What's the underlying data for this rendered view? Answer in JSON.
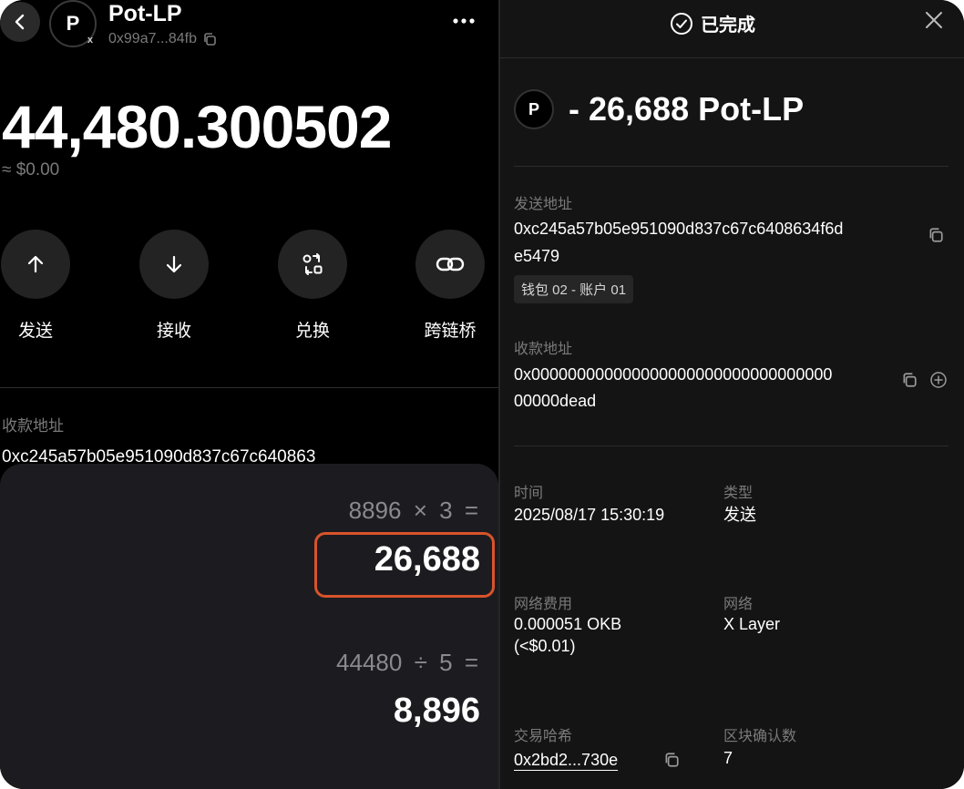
{
  "token": {
    "name": "Pot-LP",
    "avatar_letter": "P",
    "badge": "x",
    "address_short": "0x99a7...84fb",
    "balance": "44,480.300502",
    "fiat_value": "≈ $0.00"
  },
  "actions": [
    {
      "label": "发送",
      "icon": "arrow-up-icon"
    },
    {
      "label": "接收",
      "icon": "arrow-down-icon"
    },
    {
      "label": "兑换",
      "icon": "swap-icon"
    },
    {
      "label": "跨链桥",
      "icon": "bridge-icon"
    }
  ],
  "receive": {
    "title": "收款地址",
    "address": "0xc245a57b05e951090d837c67c640863"
  },
  "calculator": {
    "line1": {
      "a": "8896",
      "op": "×",
      "b": "3",
      "eq": "="
    },
    "result1": "26,688",
    "line2": {
      "a": "44480",
      "op": "÷",
      "b": "5",
      "eq": "="
    },
    "result2": "8,896",
    "highlight_color": "#d9532b"
  },
  "detail": {
    "status": "已完成",
    "avatar_letter": "P",
    "amount": "- 26,688 Pot-LP",
    "from_label": "发送地址",
    "from_address_line1": "0xc245a57b05e951090d837c67c6408634f6d",
    "from_address_line2": "e5479",
    "wallet_tag": "钱包 02 - 账户 01",
    "to_label": "收款地址",
    "to_address_line1": "0x000000000000000000000000000000000",
    "to_address_line2": "00000dead",
    "time_label": "时间",
    "time_value": "2025/08/17 15:30:19",
    "type_label": "类型",
    "type_value": "发送",
    "fee_label": "网络费用",
    "fee_value_line1": "0.000051 OKB",
    "fee_value_line2": "(<$0.01)",
    "network_label": "网络",
    "network_value": "X Layer",
    "hash_label": "交易哈希",
    "hash_value": "0x2bd2...730e",
    "confirm_label": "区块确认数",
    "confirm_value": "7"
  }
}
